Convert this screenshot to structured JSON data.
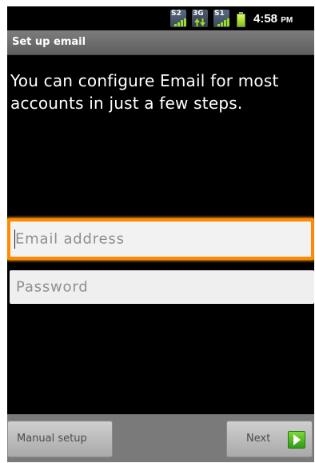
{
  "status_bar": {
    "signal_1": "S2",
    "data_indicator": "3G",
    "signal_2": "S1",
    "time": "4:58",
    "ampm": "PM"
  },
  "title_bar": {
    "title": "Set up email"
  },
  "intro_text": "You can configure Email for most accounts in just a few steps.",
  "form": {
    "email_placeholder": "Email address",
    "password_placeholder": "Password",
    "focused_field": "email"
  },
  "buttons": {
    "manual_setup": "Manual setup",
    "next": "Next"
  },
  "colors": {
    "focus_ring": "#ff8a00",
    "signal_bars": "#9bdc24",
    "next_icon": "#3fae1c"
  }
}
